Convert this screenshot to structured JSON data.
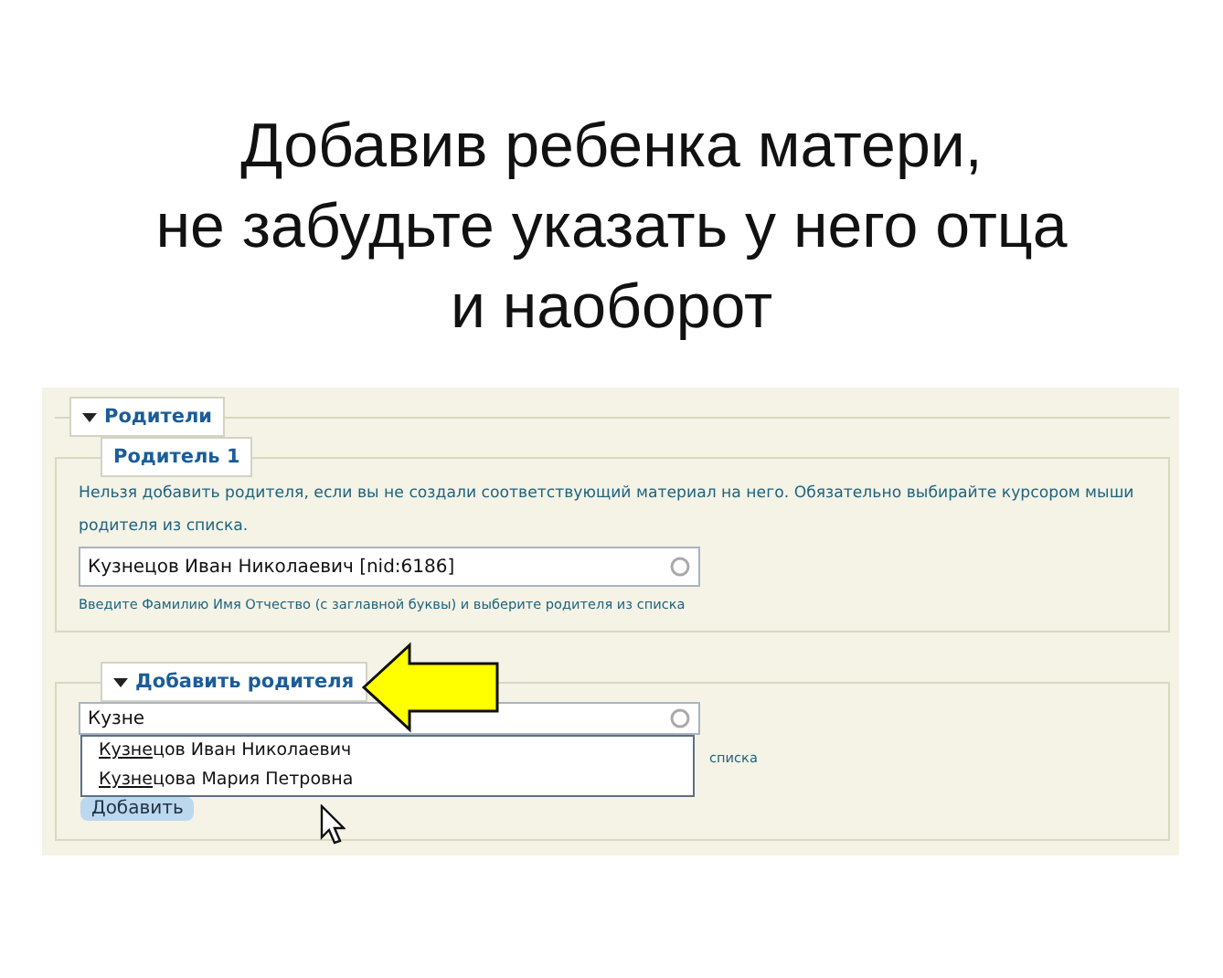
{
  "heading": [
    "Добавив ребенка матери,",
    "не забудьте указать у него отца",
    "и наоборот"
  ],
  "parents_section": {
    "legend": "Родители",
    "expanded": true,
    "parent_1": {
      "legend": "Родитель 1",
      "note": "Нельзя добавить родителя, если вы не создали соответствующий материал на него. Обязательно выбирайте курсором мыши родителя из списка.",
      "field": {
        "value": "Кузнецов Иван Николаевич [nid:6186]"
      },
      "hint": "Введите Фамилию Имя Отчество (с заглавной буквы) и выберите родителя из списка"
    },
    "add_parent": {
      "legend": "Добавить родителя",
      "expanded": true,
      "field": {
        "value": "Кузне"
      },
      "hint": "списка",
      "suggestions": [
        {
          "label": "Кузнецов Иван Николаевич"
        },
        {
          "label": "Кузнецова Мария Петровна"
        }
      ],
      "button": "Добавить"
    }
  }
}
